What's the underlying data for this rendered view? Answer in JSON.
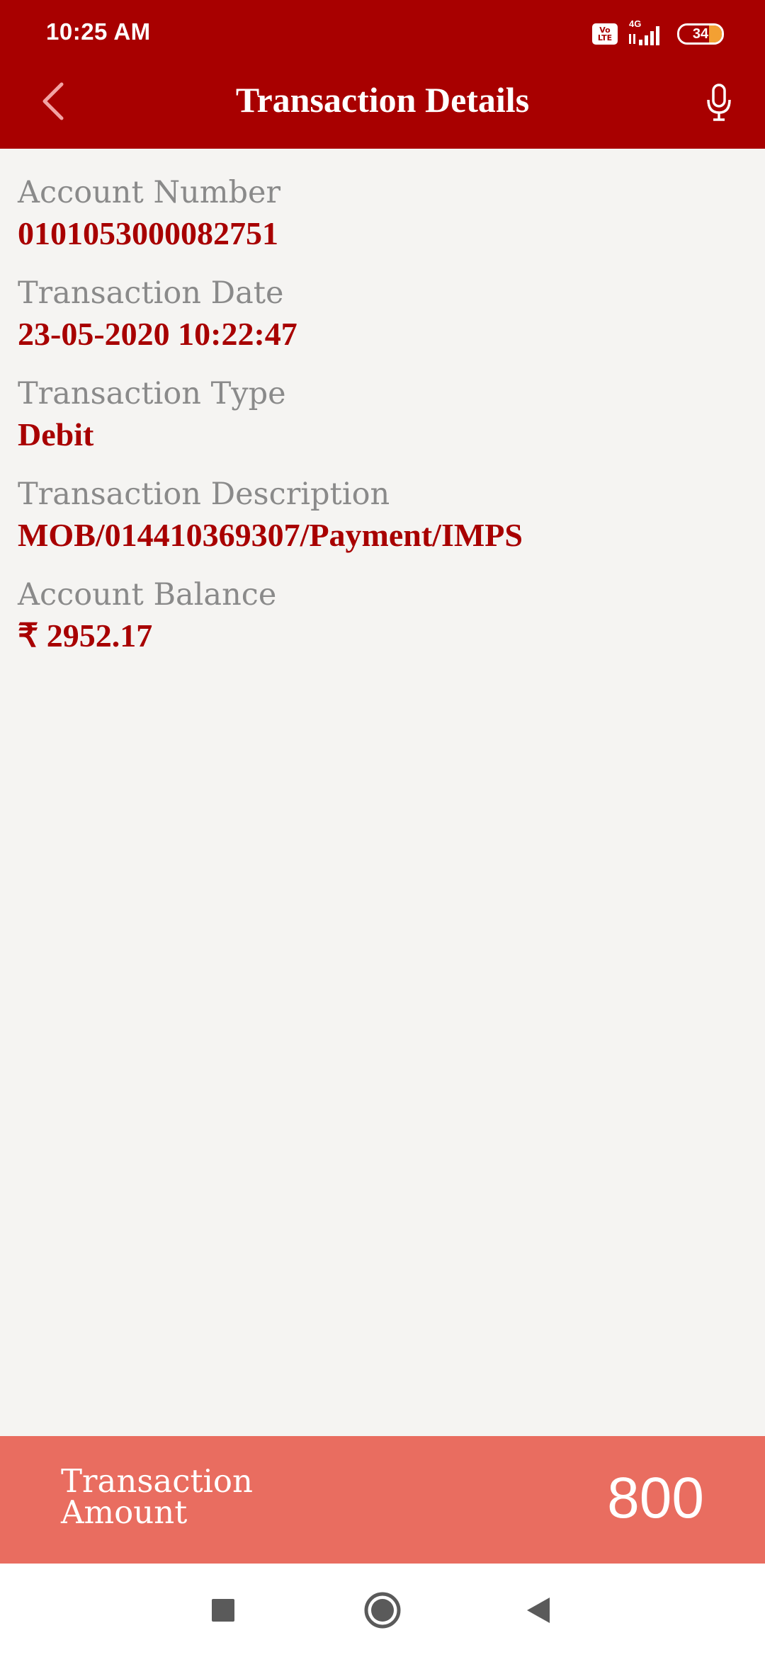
{
  "status_bar": {
    "time": "10:25 AM",
    "volte_label": "Vo LTE",
    "network_label": "4G",
    "battery_percent": 34,
    "battery_text": "34"
  },
  "header": {
    "title": "Transaction Details",
    "back_icon": "chevron-left-icon",
    "mic_icon": "microphone-icon"
  },
  "details": [
    {
      "label": "Account Number",
      "value": "0101053000082751"
    },
    {
      "label": "Transaction Date",
      "value": "23-05-2020 10:22:47"
    },
    {
      "label": "Transaction Type",
      "value": "Debit"
    },
    {
      "label": "Transaction Description",
      "value": "MOB/014410369307/Payment/IMPS"
    },
    {
      "label": "Account Balance",
      "value": "₹ 2952.17"
    }
  ],
  "amount": {
    "label": "Transaction Amount",
    "value": "800"
  },
  "nav_bar": {
    "recents_icon": "square-icon",
    "home_icon": "circle-home-icon",
    "back_icon": "triangle-back-icon"
  },
  "colors": {
    "primary": "#a80000",
    "amount_bar": "#e96d60",
    "label_gray": "#8a8a8a",
    "background": "#f5f4f2"
  }
}
